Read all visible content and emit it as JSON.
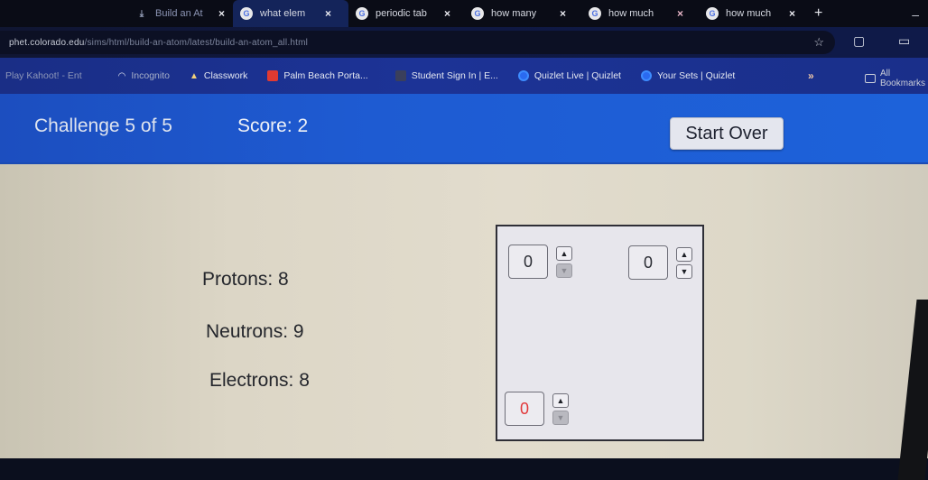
{
  "browser": {
    "tabs": [
      {
        "title": "Build an At",
        "icon": "download-icon",
        "active": false
      },
      {
        "title": "what elem",
        "icon": "google-icon",
        "active": true
      },
      {
        "title": "periodic tab",
        "icon": "google-icon",
        "active": false
      },
      {
        "title": "how many",
        "icon": "google-icon",
        "active": false
      },
      {
        "title": "how much",
        "icon": "google-icon",
        "active": false
      },
      {
        "title": "how much",
        "icon": "google-icon",
        "active": false
      }
    ],
    "new_tab_label": "+",
    "minimize_label": "–",
    "url_domain": "phet.colorado.edu",
    "url_path": "/sims/html/build-an-atom/latest/build-an-atom_all.html",
    "bookmarks": [
      {
        "label": "Play Kahoot! - Ent",
        "icon": "kahoot-icon"
      },
      {
        "label": "Incognito",
        "icon": "incognito-icon"
      },
      {
        "label": "Classwork",
        "icon": "classroom-icon"
      },
      {
        "label": "Palm Beach Porta...",
        "icon": "portal-icon"
      },
      {
        "label": "Student Sign In | E...",
        "icon": "edgenuity-icon"
      },
      {
        "label": "Quizlet Live | Quizlet",
        "icon": "quizlet-icon"
      },
      {
        "label": "Your Sets | Quizlet",
        "icon": "quizlet-icon"
      }
    ],
    "bookmarks_overflow": "»",
    "all_bookmarks_label": "All Bookmarks"
  },
  "sim": {
    "challenge_label": "Challenge 5 of 5",
    "score_label": "Score: 2",
    "start_over_label": "Start Over",
    "particles": {
      "protons": "Protons: 8",
      "neutrons": "Neutrons: 9",
      "electrons": "Electrons: 8"
    },
    "answers": {
      "top_left": {
        "value": "0",
        "up_enabled": true,
        "down_enabled": false
      },
      "top_right": {
        "value": "0",
        "up_enabled": true,
        "down_enabled": true
      },
      "bottom_left": {
        "value": "0",
        "up_enabled": true,
        "down_enabled": false
      }
    },
    "arrow_up": "▲",
    "arrow_down": "▼"
  },
  "colors": {
    "sim_nav_blue": "#1e5bd2",
    "play_background": "#e2dccd",
    "charge_value_red": "#e2383a"
  }
}
